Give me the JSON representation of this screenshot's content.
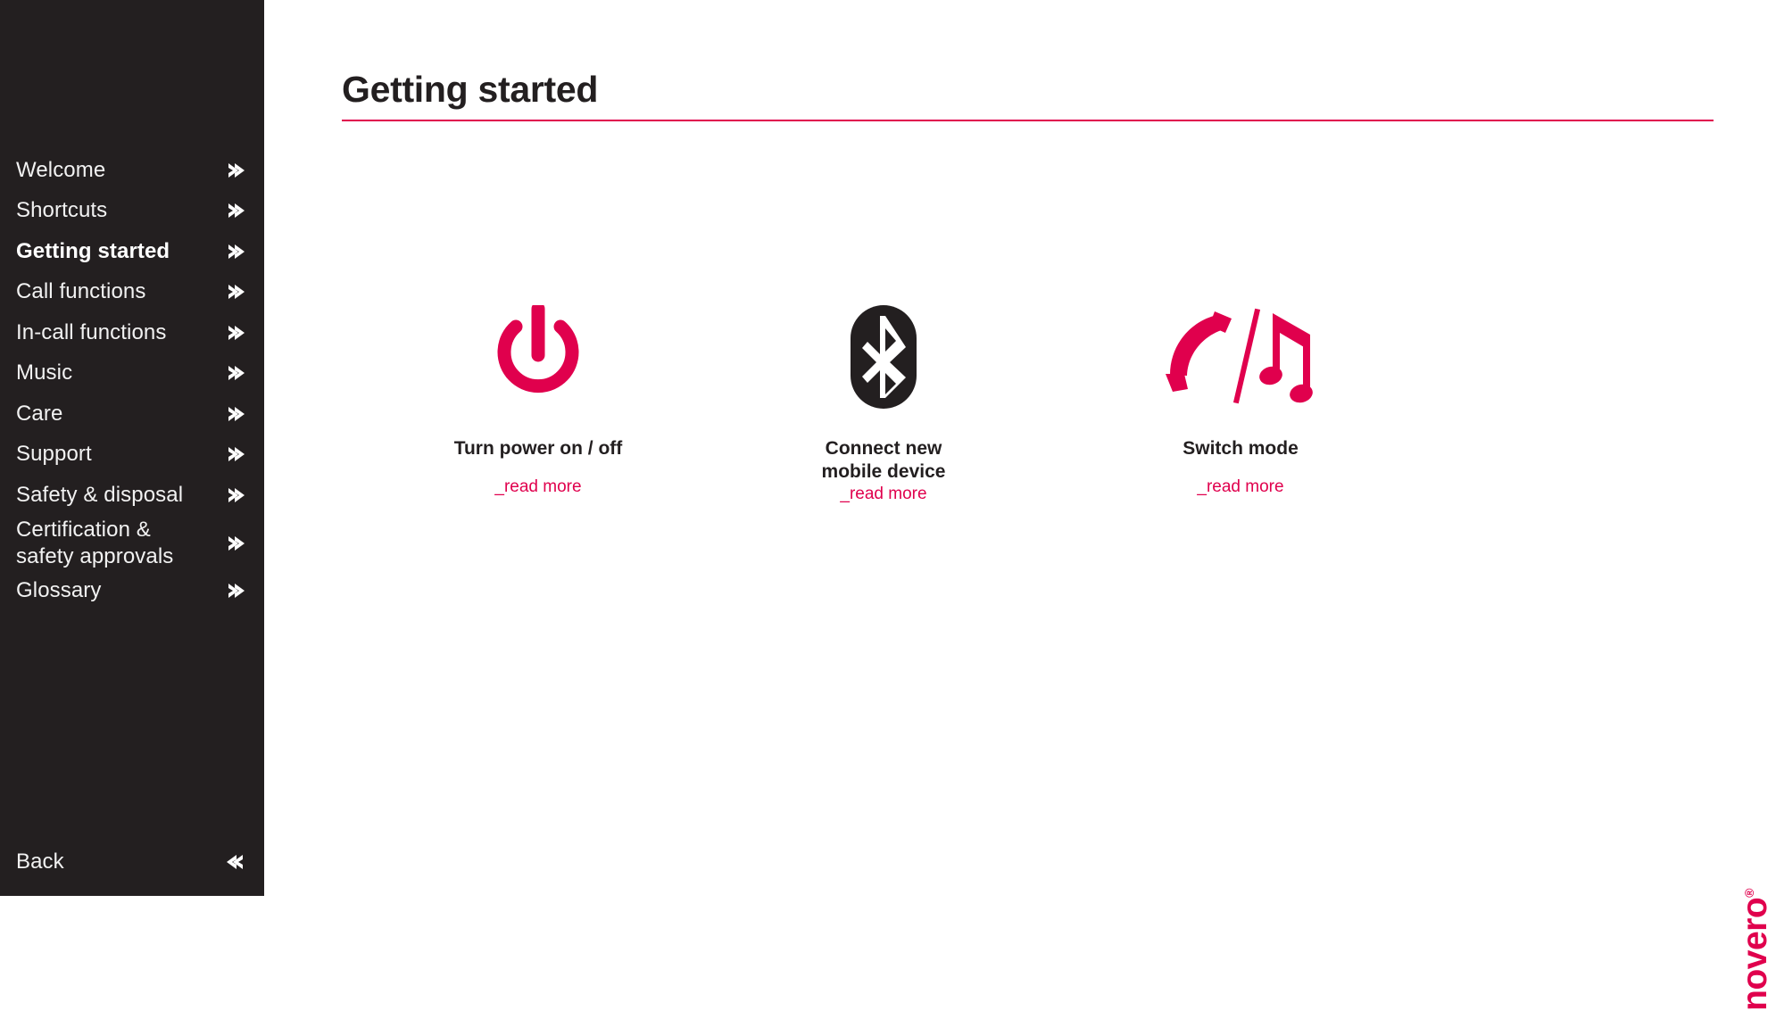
{
  "sidebar": {
    "items": [
      {
        "label": "Welcome",
        "icon": "chevron-right-icon",
        "active": false
      },
      {
        "label": "Shortcuts",
        "icon": "chevron-right-icon",
        "active": false
      },
      {
        "label": "Getting started",
        "icon": "chevron-right-icon",
        "active": true
      },
      {
        "label": "Call functions",
        "icon": "chevron-right-icon",
        "active": false
      },
      {
        "label": "In-call functions",
        "icon": "chevron-right-icon",
        "active": false
      },
      {
        "label": "Music",
        "icon": "chevron-right-icon",
        "active": false
      },
      {
        "label": "Care",
        "icon": "chevron-right-icon",
        "active": false
      },
      {
        "label": "Support",
        "icon": "chevron-right-icon",
        "active": false
      },
      {
        "label": "Safety & disposal",
        "icon": "chevron-right-icon",
        "active": false
      },
      {
        "label": "Certification &\nsafety approvals",
        "icon": "chevron-right-icon",
        "active": false
      },
      {
        "label": "Glossary",
        "icon": "chevron-right-icon",
        "active": false
      }
    ],
    "back": {
      "label": "Back",
      "icon": "chevron-left-icon"
    },
    "background_color": "#231f20",
    "text_color": "#f2f2f2"
  },
  "main": {
    "title": "Getting started",
    "rule_color": "#e0004d",
    "cards": [
      {
        "icon": "power-icon",
        "title": "Turn power on / off",
        "link": "_read more"
      },
      {
        "icon": "bluetooth-icon",
        "title": "Connect new\nmobile device",
        "link": "_read more"
      },
      {
        "icon": "phone-music-switch-icon",
        "title": "Switch mode",
        "link": "_read more"
      }
    ]
  },
  "logo": {
    "text": "novero",
    "registered": "®",
    "color": "#e0004d"
  },
  "colors": {
    "accent_pink": "#e0004d",
    "dark": "#231f20",
    "white": "#ffffff"
  }
}
